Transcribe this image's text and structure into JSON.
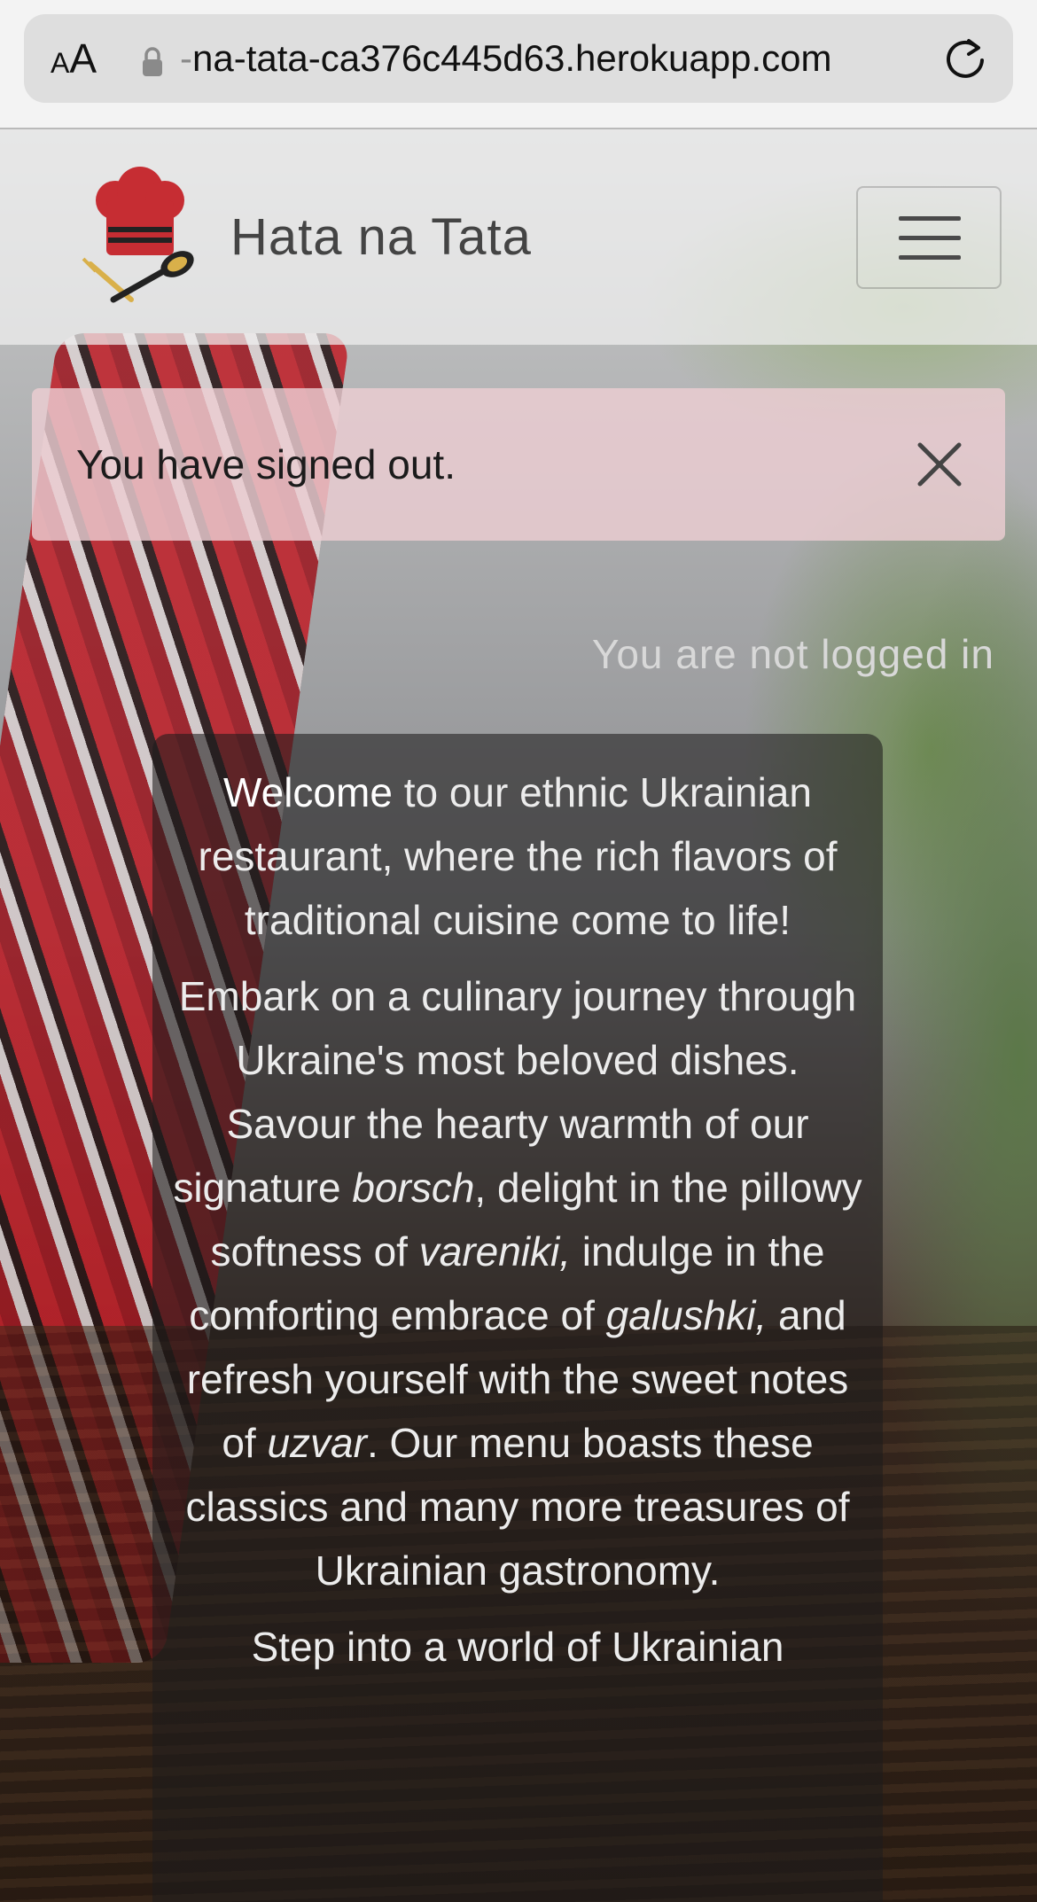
{
  "browser": {
    "aa_small": "A",
    "aa_big": "A",
    "url_fade": "-",
    "url": "na-tata-ca376c445d63.herokuapp.com"
  },
  "navbar": {
    "brand": "Hata na Tata"
  },
  "alert": {
    "message": "You have signed out."
  },
  "status": {
    "login": "You are not logged in"
  },
  "welcome": {
    "p1_strong": "Welcome",
    "p1_rest": " to our ethnic Ukrainian restaurant, where the rich flavors of traditional cuisine come to life!",
    "p2_a": "Embark on a culinary journey through Ukraine's most beloved dishes. Savour the hearty warmth of our signature ",
    "dish1": "borsch",
    "p2_b": ", delight in the pillowy softness of ",
    "dish2": "vareniki,",
    "p2_c": " indulge in the comforting embrace of ",
    "dish3": "galushki,",
    "p2_d": " and refresh yourself with the sweet notes of ",
    "dish4": "uzvar",
    "p2_e": ". Our menu boasts these classics and many more treasures of Ukrainian gastronomy.",
    "p3": "Step into a world of Ukrainian"
  },
  "colors": {
    "alert_bg": "#ecd0d4",
    "logo_red": "#c62d33",
    "navbar_text": "#444444"
  },
  "icons": {
    "lock": "lock-icon",
    "reload": "reload-icon",
    "menu": "hamburger-icon",
    "close": "close-icon",
    "logo": "chef-hat-logo"
  }
}
